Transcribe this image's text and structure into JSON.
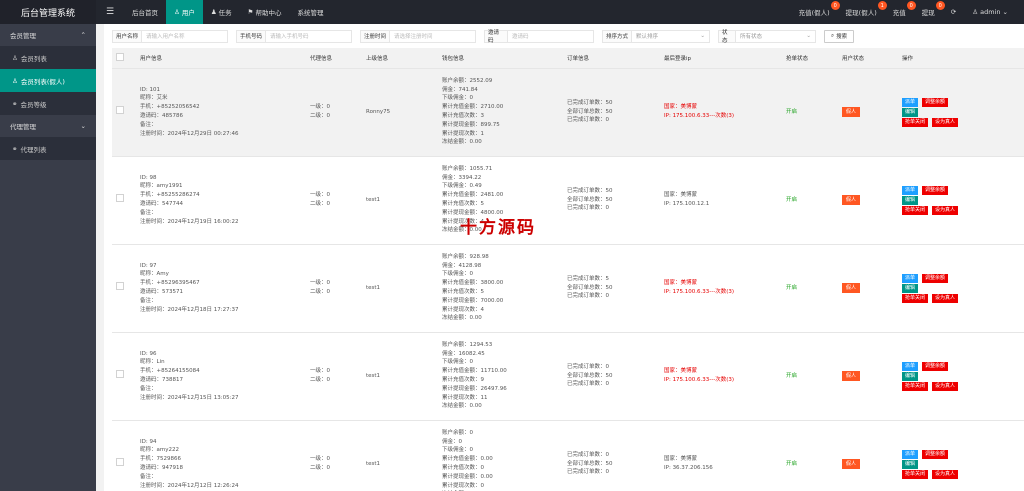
{
  "app_title": "后台管理系统",
  "topnav": [
    {
      "label": "后台首页"
    },
    {
      "label": "用户"
    },
    {
      "label": "任务"
    },
    {
      "label": "帮助中心"
    },
    {
      "label": "系统管理"
    }
  ],
  "top_right": [
    {
      "label": "充值(假人)",
      "badge": "0"
    },
    {
      "label": "提现(假人)",
      "badge": "1"
    },
    {
      "label": "充值",
      "badge": "0"
    },
    {
      "label": "提现",
      "badge": "0"
    }
  ],
  "user_label": "admin",
  "sidebar": {
    "groups": [
      {
        "label": "会员管理",
        "items": [
          "会员列表",
          "会员列表(假人)",
          "会员等级"
        ]
      },
      {
        "label": "代理管理",
        "items": [
          "代理列表"
        ]
      }
    ]
  },
  "filters": {
    "username_label": "用户名称",
    "username_ph": "请输入用户名称",
    "phone_label": "手机号码",
    "phone_ph": "请输入手机号码",
    "regtime_label": "注册时间",
    "regtime_ph": "请选择注册时间",
    "invite_label": "邀请码",
    "invite_ph": "邀请码",
    "sort_label": "排序方式",
    "sort_value": "默认排序",
    "status_label": "状态",
    "status_value": "所有状态",
    "search_label": "搜索"
  },
  "columns": [
    "用户信息",
    "代理信息",
    "上级信息",
    "钱包信息",
    "订单信息",
    "最后登录ip",
    "抢单状态",
    "用户状态",
    "操作"
  ],
  "labels": {
    "id": "ID",
    "nick": "昵称",
    "phone": "手机",
    "invite": "邀请码",
    "note": "备注",
    "regtime": "注册时间",
    "lvl1": "一级",
    "lvl2": "二级",
    "balance": "账户余额",
    "commission": "佣金",
    "lower_commission": "下级佣金",
    "total_recharge": "累计充值金额",
    "recharge_times": "累计充值次数",
    "total_withdraw": "累计提现金额",
    "withdraw_times": "累计提现次数",
    "frozen": "冻结金额",
    "done": "已完成订单数",
    "all": "全部订单总数",
    "cancel": "已完成订单数",
    "country": "国家",
    "ip": "IP"
  },
  "buttons": {
    "deposit": "派单",
    "adjust": "调整余额",
    "edit": "编辑",
    "close_grab": "抢单关闭",
    "set_real": "设为真人"
  },
  "rows": [
    {
      "id": "101",
      "nick": "艾米",
      "phone": "+85252056542",
      "invite": "485786",
      "regtime": "2024年12月29日 00:27:46",
      "lvl1": "0",
      "lvl2": "0",
      "parent": "Ronny75",
      "balance": "2552.09",
      "commission": "741.84",
      "lower": "0",
      "recharge": "2710.00",
      "rtimes": "3",
      "withdraw": "899.75",
      "wtimes": "1",
      "frozen": "0.00",
      "done": "50",
      "all": "50",
      "cancel": "0",
      "country": "美博蒙",
      "ip": "175.100.6.33---次数(3)",
      "ip_red": true,
      "grab": "开启",
      "status": "假人"
    },
    {
      "id": "98",
      "nick": "amy1991",
      "phone": "+85255286274",
      "invite": "547744",
      "regtime": "2024年12月19日 16:00:22",
      "lvl1": "0",
      "lvl2": "0",
      "parent": "test1",
      "balance": "1055.71",
      "commission": "3394.22",
      "lower": "0.49",
      "recharge": "2481.00",
      "rtimes": "5",
      "withdraw": "4800.00",
      "wtimes": "4",
      "frozen": "0.00",
      "done": "50",
      "all": "50",
      "cancel": "0",
      "country": "美博蒙",
      "ip": "175.100.12.1",
      "ip_red": false,
      "grab": "开启",
      "status": "假人"
    },
    {
      "id": "97",
      "nick": "Amy",
      "phone": "+85296395467",
      "invite": "573571",
      "regtime": "2024年12月18日 17:27:37",
      "lvl1": "0",
      "lvl2": "0",
      "parent": "test1",
      "balance": "928.98",
      "commission": "4128.98",
      "lower": "0",
      "recharge": "3800.00",
      "rtimes": "5",
      "withdraw": "7000.00",
      "wtimes": "4",
      "frozen": "0.00",
      "done": "5",
      "all": "50",
      "cancel": "0",
      "country": "美博蒙",
      "ip": "175.100.6.33---次数(3)",
      "ip_red": true,
      "grab": "开启",
      "status": "假人"
    },
    {
      "id": "96",
      "nick": "Lin",
      "phone": "+85264155084",
      "invite": "738817",
      "regtime": "2024年12月15日 13:05:27",
      "lvl1": "0",
      "lvl2": "0",
      "parent": "test1",
      "balance": "1294.53",
      "commission": "16082.45",
      "lower": "0",
      "recharge": "11710.00",
      "rtimes": "9",
      "withdraw": "26497.96",
      "wtimes": "11",
      "frozen": "0.00",
      "done": "0",
      "all": "50",
      "cancel": "0",
      "country": "美博蒙",
      "ip": "175.100.6.33---次数(3)",
      "ip_red": true,
      "grab": "开启",
      "status": "假人"
    },
    {
      "id": "94",
      "nick": "amy222",
      "phone": "7529866",
      "invite": "947918",
      "regtime": "2024年12月12日 12:26:24",
      "lvl1": "0",
      "lvl2": "0",
      "parent": "test1",
      "balance": "0",
      "commission": "0",
      "lower": "0",
      "recharge": "0.00",
      "rtimes": "0",
      "withdraw": "0.00",
      "wtimes": "0",
      "frozen": "0.00",
      "done": "0",
      "all": "50",
      "cancel": "0",
      "country": "美博蒙",
      "ip": "36.37.206.156",
      "ip_red": false,
      "grab": "开启",
      "status": "假人"
    }
  ],
  "watermark": "十方源码"
}
